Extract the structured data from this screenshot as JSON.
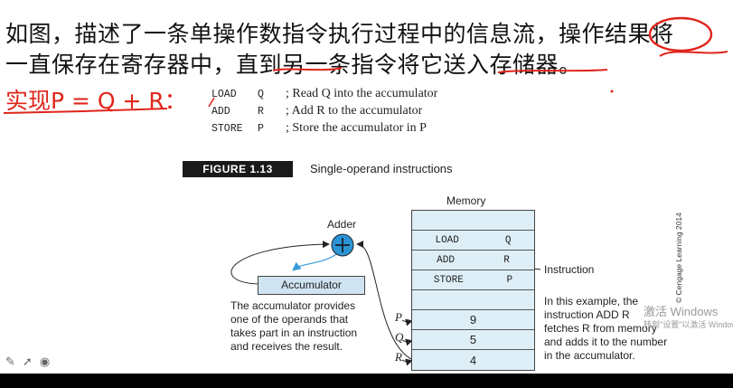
{
  "heading_line1": "如图，描述了一条单操作数指令执行过程中的信息流，操作结果将",
  "heading_line2": "一直保存在寄存器中，直到另一条指令将它送入存储器。",
  "implementation_label": "实现P = Q + R：",
  "code_lines": [
    {
      "op": "LOAD",
      "arg": "Q",
      "comment": "; Read Q  into the accumulator"
    },
    {
      "op": "ADD",
      "arg": "R",
      "comment": "; Add R  to the accumulator"
    },
    {
      "op": "STORE",
      "arg": "P",
      "comment": "; Store the accumulator in P"
    }
  ],
  "figure": {
    "badge": "FIGURE 1.13",
    "title": "Single-operand instructions",
    "memory_label": "Memory",
    "adder_label": "Adder",
    "accumulator_label": "Accumulator",
    "instruction_label": "Instruction",
    "memory_rows": [
      {
        "c1": "",
        "c2": ""
      },
      {
        "c1": "LOAD",
        "c2": "Q"
      },
      {
        "c1": "ADD",
        "c2": "R"
      },
      {
        "c1": "STORE",
        "c2": "P"
      },
      {
        "c1": "",
        "c2": ""
      }
    ],
    "registers": [
      {
        "name": "P",
        "value": "9"
      },
      {
        "name": "Q",
        "value": "5"
      },
      {
        "name": "R",
        "value": "4"
      }
    ],
    "acc_description": [
      "The accumulator provides",
      "one of the operands that",
      "takes part in an instruction",
      "and receives the result."
    ],
    "example_description": [
      "In this example, the",
      "instruction ADD  R",
      "fetches R from memory",
      "and adds it to the number",
      "in the accumulator."
    ],
    "copyright": "© Cengage Learning 2014"
  },
  "watermark": {
    "line1": "激活 Windows",
    "line2": "转到\"设置\"以激活 Windows"
  },
  "colors": {
    "accent_red": "#e0251b",
    "memory_fill": "#ddeef7",
    "adder_fill": "#2a94d6",
    "arrow_blue": "#3a9ad9"
  }
}
